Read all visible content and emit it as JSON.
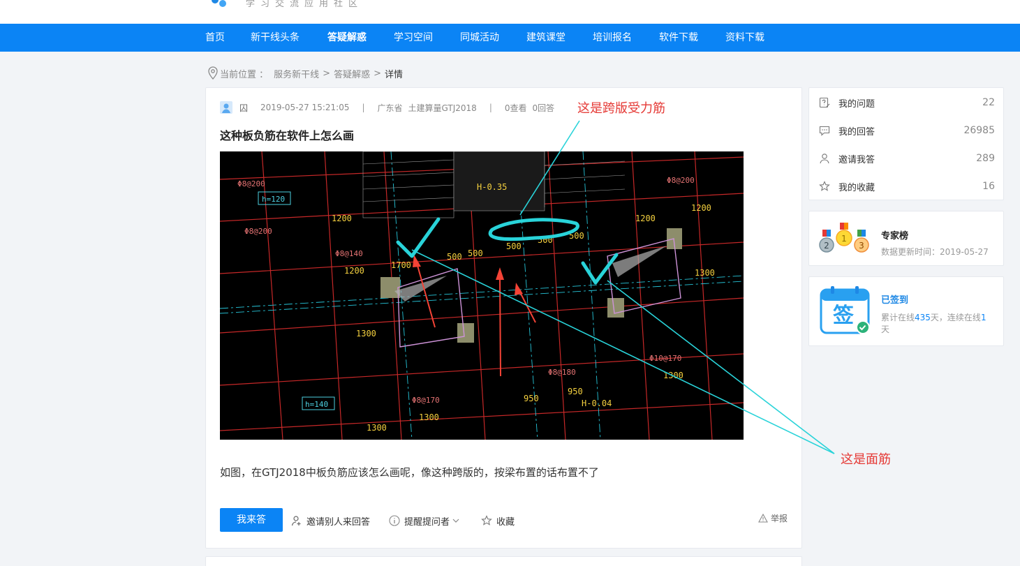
{
  "header": {
    "slogan": "学习交流应用社区"
  },
  "nav": {
    "items": [
      "首页",
      "新干线头条",
      "答疑解惑",
      "学习空间",
      "同城活动",
      "建筑课堂",
      "培训报名",
      "软件下载",
      "资料下载"
    ],
    "active": "答疑解惑"
  },
  "breadcrumb": {
    "prefix": "当前位置 ：",
    "items": [
      "服务新干线",
      "答疑解惑",
      "详情"
    ],
    "separator": ">"
  },
  "question": {
    "user": "囚",
    "datetime": "2019-05-27 15:21:05",
    "region": "广东省",
    "software": "土建算量GTJ2018",
    "views": "0查看",
    "answers": "0回答",
    "title": "这种板负筋在软件上怎么画",
    "body": "如图，在GTJ2018中板负筋应该怎么画呢，像这种跨版的，按梁布置的话布置不了"
  },
  "cad_labels": {
    "h_top": "H-0.35",
    "h_bottom": "H-0.04",
    "h120": "h=120",
    "h140": "h=140",
    "dim_1200": "1200",
    "dim_1300": "1300",
    "dim_1700": "1700",
    "dim_500": "500",
    "dim_950": "950",
    "rebar_200": "Φ8@200",
    "rebar_140": "Φ8@140",
    "rebar_170": "Φ8@170",
    "rebar_180": "Φ8@180",
    "rebar_10_170": "Φ10@170"
  },
  "actions": {
    "answer": "我来答",
    "invite": "邀请别人来回答",
    "remind": "提醒提问者",
    "favorite": "收藏",
    "report": "举报"
  },
  "sidebar": {
    "stats": [
      {
        "label": "我的问题",
        "count": "22",
        "icon": "question-edit-icon"
      },
      {
        "label": "我的回答",
        "count": "26985",
        "icon": "chat-icon"
      },
      {
        "label": "邀请我答",
        "count": "289",
        "icon": "user-icon"
      },
      {
        "label": "我的收藏",
        "count": "16",
        "icon": "star-icon"
      }
    ],
    "experts": {
      "title": "专家榜",
      "updated_label": "数据更新时间：",
      "updated_date": "2019-05-27"
    },
    "sign": {
      "status": "已签到",
      "icon_char": "签",
      "text_a": "累计在线",
      "days_total": "435",
      "text_b": "天，连续在线",
      "days_streak": "1",
      "text_c": "天"
    }
  },
  "annotations": {
    "cross_span": "这是跨版受力筋",
    "top_bar": "这是面筋"
  },
  "colors": {
    "brand_blue": "#0b84f5",
    "annotation_red": "#e53935",
    "annotation_cyan": "#29d3d9"
  }
}
